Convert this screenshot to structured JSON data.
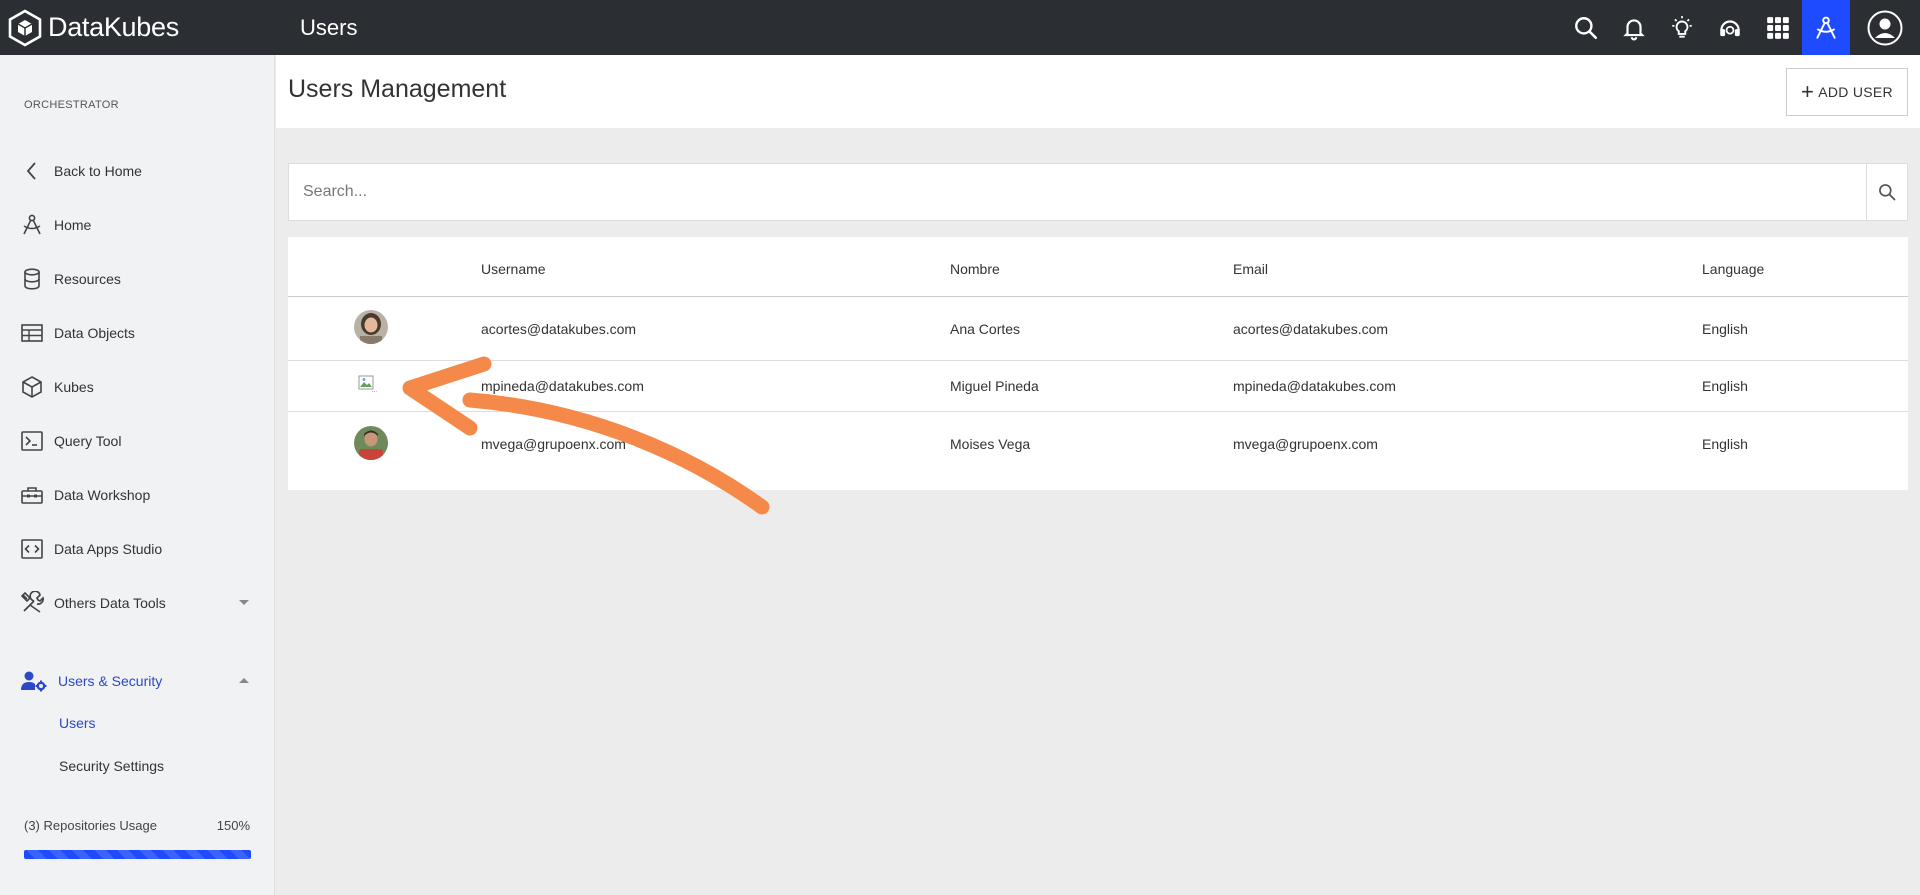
{
  "app": {
    "brand": "DataKubes",
    "page_title": "Users"
  },
  "sidebar": {
    "section": "ORCHESTRATOR",
    "items": [
      {
        "label": "Back to Home",
        "icon": "chevron-left-icon"
      },
      {
        "label": "Home",
        "icon": "compass-icon"
      },
      {
        "label": "Resources",
        "icon": "database-icon"
      },
      {
        "label": "Data Objects",
        "icon": "table-icon"
      },
      {
        "label": "Kubes",
        "icon": "cube-icon"
      },
      {
        "label": "Query Tool",
        "icon": "terminal-icon"
      },
      {
        "label": "Data Workshop",
        "icon": "toolbox-icon"
      },
      {
        "label": "Data Apps Studio",
        "icon": "code-icon"
      },
      {
        "label": "Others Data Tools",
        "icon": "tools-icon"
      },
      {
        "label": "Users & Security",
        "icon": "user-gear-icon"
      }
    ],
    "sub_items": [
      {
        "label": "Users"
      },
      {
        "label": "Security Settings"
      }
    ],
    "usage": {
      "label": "(3) Repositories Usage",
      "percent_text": "150%",
      "fill_fraction": 1.0
    }
  },
  "main": {
    "heading": "Users Management",
    "add_user_label": "ADD USER",
    "search": {
      "placeholder": "Search...",
      "value": ""
    },
    "table": {
      "columns": [
        "Username",
        "Nombre",
        "Email",
        "Language"
      ],
      "rows": [
        {
          "username": "acortes@datakubes.com",
          "nombre": "Ana Cortes",
          "email": "acortes@datakubes.com",
          "language": "English"
        },
        {
          "username": "mpineda@datakubes.com",
          "nombre": "Miguel Pineda",
          "email": "mpineda@datakubes.com",
          "language": "English"
        },
        {
          "username": "mvega@grupoenx.com",
          "nombre": "Moises Vega",
          "email": "mvega@grupoenx.com",
          "language": "English"
        }
      ]
    }
  },
  "colors": {
    "topbar": "#2b2f33",
    "accent": "#1e4bff",
    "active_text": "#2a48c8",
    "annotation_arrow": "#f5894a"
  }
}
